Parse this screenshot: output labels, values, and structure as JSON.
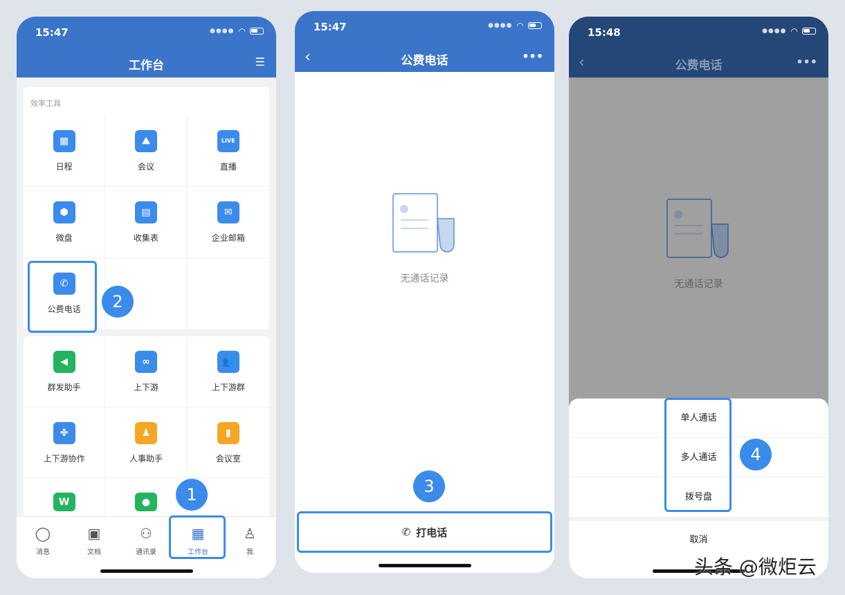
{
  "phone1": {
    "time": "15:47",
    "title": "工作台",
    "section_title": "效率工具",
    "apps_a": [
      {
        "label": "日程",
        "icon": "calendar-icon"
      },
      {
        "label": "会议",
        "icon": "meeting-icon"
      },
      {
        "label": "直播",
        "icon": "live-icon",
        "glyph": "LIVE"
      },
      {
        "label": "微盘",
        "icon": "drive-icon"
      },
      {
        "label": "收集表",
        "icon": "form-icon"
      },
      {
        "label": "企业邮箱",
        "icon": "mail-icon"
      },
      {
        "label": "公费电话",
        "icon": "phone-icon"
      }
    ],
    "apps_b": [
      {
        "label": "群发助手",
        "icon": "megaphone-icon"
      },
      {
        "label": "上下游",
        "icon": "link-icon"
      },
      {
        "label": "上下游群",
        "icon": "group-icon"
      },
      {
        "label": "上下游协作",
        "icon": "collab-icon"
      },
      {
        "label": "人事助手",
        "icon": "hr-icon"
      },
      {
        "label": "会议室",
        "icon": "door-icon"
      }
    ],
    "tabs": [
      {
        "label": "消息",
        "icon": "chat-bubble-icon"
      },
      {
        "label": "文档",
        "icon": "document-icon"
      },
      {
        "label": "通讯录",
        "icon": "org-chart-icon"
      },
      {
        "label": "工作台",
        "icon": "grid-icon"
      },
      {
        "label": "我",
        "icon": "person-icon"
      }
    ],
    "badge_1": "1",
    "badge_2": "2"
  },
  "phone2": {
    "time": "15:47",
    "title": "公费电话",
    "empty_text": "无通话记录",
    "call_button": "打电话",
    "badge_3": "3"
  },
  "phone3": {
    "time": "15:48",
    "title": "公费电话",
    "empty_text": "无通话记录",
    "options": [
      "单人通话",
      "多人通话",
      "拨号盘"
    ],
    "cancel": "取消",
    "badge_4": "4"
  },
  "watermark": "头条 @微炬云",
  "colors": {
    "accent": "#3a75c9",
    "highlight": "#3b8beb",
    "green": "#24b360",
    "orange": "#f5a623"
  }
}
